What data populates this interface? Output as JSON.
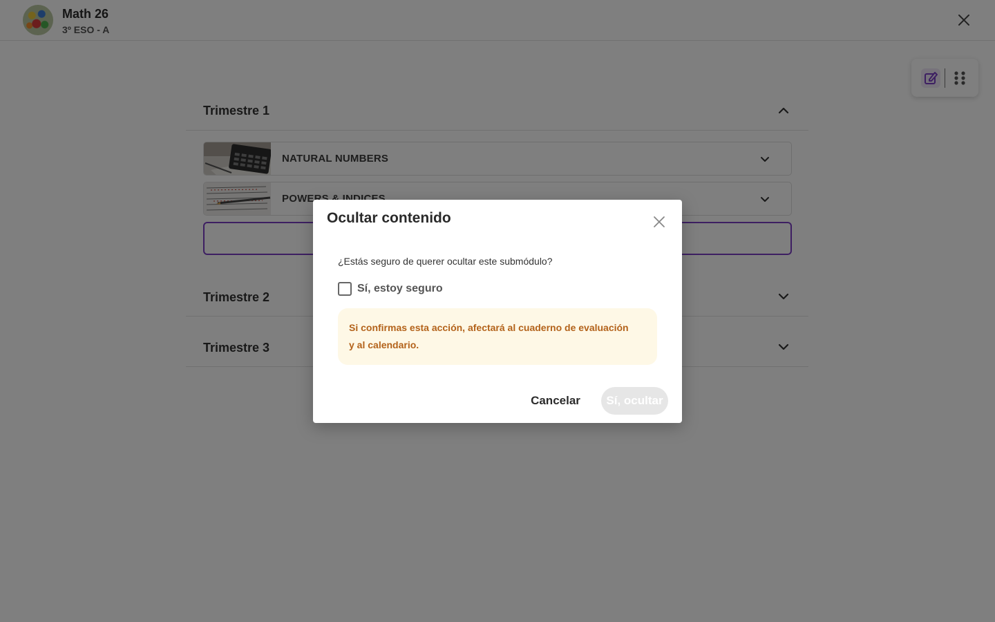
{
  "header": {
    "course_title": "Math 26",
    "course_subtitle": "3º ESO - A",
    "close_icon": "close-icon"
  },
  "toolbar": {
    "edit_icon": "edit-icon",
    "grip_icon": "drag-grip-icon",
    "accent_color": "#7b3fc4"
  },
  "sections": [
    {
      "title": "Trimestre 1",
      "expanded": true
    },
    {
      "title": "Trimestre 2",
      "expanded": false
    },
    {
      "title": "Trimestre 3",
      "expanded": false
    }
  ],
  "modules": [
    {
      "title": "NATURAL NUMBERS",
      "thumb": "calculator-image"
    },
    {
      "title": "POWERS & INDICES",
      "thumb": "notebook-pencil-image"
    }
  ],
  "dialog": {
    "title": "Ocultar contenido",
    "question": "¿Estás seguro de querer ocultar este submódulo?",
    "checkbox_label": "Sí, estoy seguro",
    "checkbox_checked": false,
    "warning": "Si confirmas esta acción, afectará al cuaderno de evaluación y al calendario.",
    "cancel_label": "Cancelar",
    "confirm_label": "Sí, ocultar",
    "warning_bg": "#fef8e6",
    "warning_color": "#b3621a"
  }
}
